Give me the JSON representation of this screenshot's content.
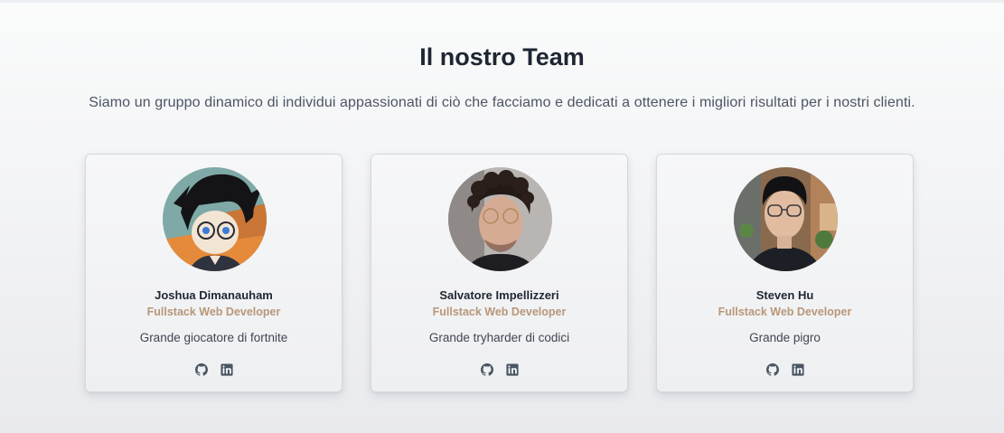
{
  "section": {
    "title": "Il nostro Team",
    "subtitle": "Siamo un gruppo dinamico di individui appassionati di ciò che facciamo e dedicati a ottenere i migliori risultati per i nostri clienti."
  },
  "members": [
    {
      "name": "Joshua Dimanauham",
      "role": "Fullstack Web Developer",
      "description": "Grande giocatore di fortnite",
      "avatar": "anime-character-avatar",
      "links": [
        "github-icon",
        "linkedin-icon"
      ]
    },
    {
      "name": "Salvatore Impellizzeri",
      "role": "Fullstack Web Developer",
      "description": "Grande tryharder di codici",
      "avatar": "curly-hair-glasses-portrait",
      "links": [
        "github-icon",
        "linkedin-icon"
      ]
    },
    {
      "name": "Steven Hu",
      "role": "Fullstack Web Developer",
      "description": "Grande pigro",
      "avatar": "glasses-indoor-portrait",
      "links": [
        "github-icon",
        "linkedin-icon"
      ]
    }
  ],
  "colors": {
    "role_accent": "#b8977a",
    "title": "#1e2634",
    "subtitle": "#4b5563",
    "icon": "#4b5563"
  }
}
